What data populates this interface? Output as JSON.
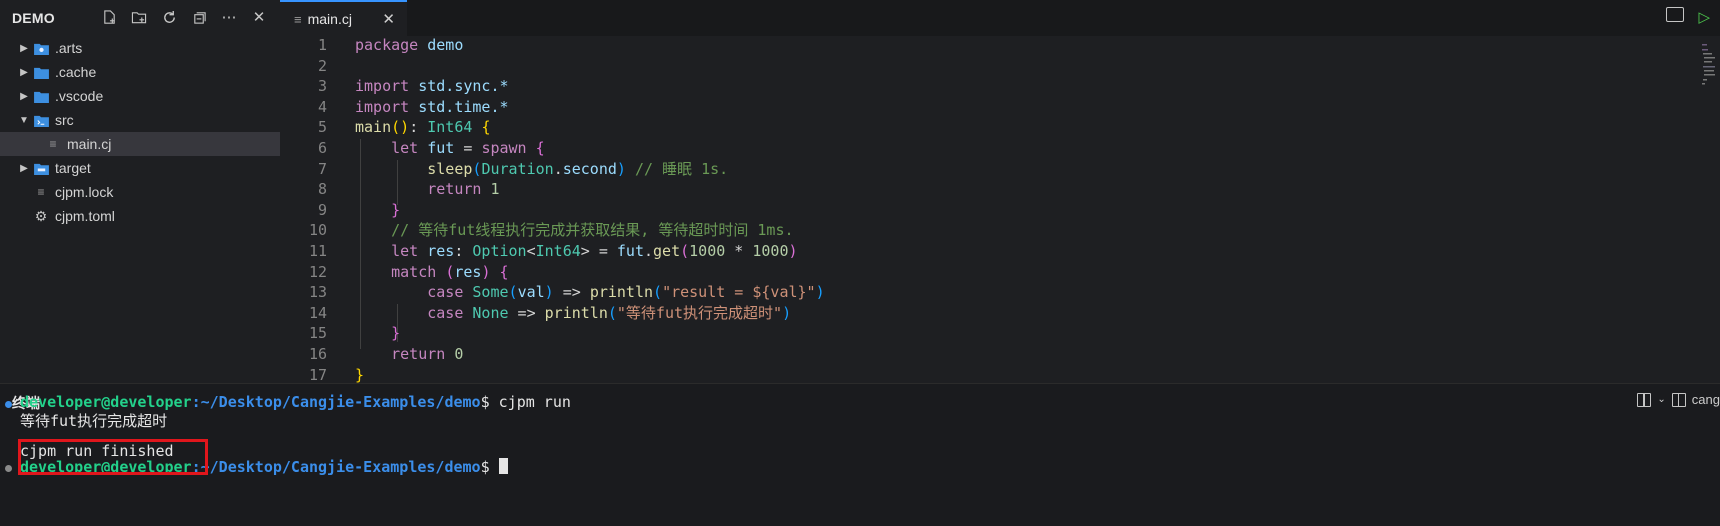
{
  "sidebar": {
    "title": "DEMO",
    "items": [
      {
        "label": ".arts",
        "kind": "folder-collapsed"
      },
      {
        "label": ".cache",
        "kind": "folder-collapsed"
      },
      {
        "label": ".vscode",
        "kind": "folder-collapsed"
      },
      {
        "label": "src",
        "kind": "folder-expanded"
      },
      {
        "label": "main.cj",
        "kind": "file-selected"
      },
      {
        "label": "target",
        "kind": "folder-collapsed"
      },
      {
        "label": "cjpm.lock",
        "kind": "file"
      },
      {
        "label": "cjpm.toml",
        "kind": "settings-file"
      }
    ],
    "actions": [
      "new-file-icon",
      "new-folder-icon",
      "refresh-icon",
      "collapse-all-icon",
      "more-icon",
      "close-icon"
    ]
  },
  "tab": {
    "label": "main.cj"
  },
  "editor": {
    "line_numbers": [
      "1",
      "2",
      "3",
      "4",
      "5",
      "6",
      "7",
      "8",
      "9",
      "10",
      "11",
      "12",
      "13",
      "14",
      "15",
      "16",
      "17"
    ],
    "code": {
      "l1_kw": "package",
      "l1_id": "demo",
      "l3_kw": "import",
      "l3_id": "std.sync.*",
      "l4_kw": "import",
      "l4_id": "std.time.*",
      "l5_fn": "main",
      "l5_p": "()",
      "l5_colon": ": ",
      "l5_ty": "Int64",
      "l5_br": "{",
      "l6_kw": "let",
      "l6_id": "fut",
      "l6_eq": " = ",
      "l6_fn": "spawn",
      "l6_br": "{",
      "l7_fn": "sleep",
      "l7_p1": "(",
      "l7_ty": "Duration",
      "l7_dot": ".",
      "l7_id": "second",
      "l7_p2": ")",
      "l7_cm": "// 睡眠 1s.",
      "l8_kw": "return",
      "l8_nu": "1",
      "l9_br": "}",
      "l10_cm": "// 等待fut线程执行完成并获取结果, 等待超时时间 1ms.",
      "l11_kw": "let",
      "l11_id": "res",
      "l11_colon": ": ",
      "l11_ty1": "Option",
      "l11_lt": "<",
      "l11_ty2": "Int64",
      "l11_gt": ">",
      "l11_eq": " = ",
      "l11_id2": "fut",
      "l11_dot": ".",
      "l11_fn": "get",
      "l11_p1": "(",
      "l11_nu1": "1000",
      "l11_op": " * ",
      "l11_nu2": "1000",
      "l11_p2": ")",
      "l12_kw": "match",
      "l12_p1": "(",
      "l12_id": "res",
      "l12_p2": ")",
      "l12_br": "{",
      "l13_kw": "case",
      "l13_ty": "Some",
      "l13_p1": "(",
      "l13_id": "val",
      "l13_p2": ")",
      "l13_arrow": " => ",
      "l13_fn": "println",
      "l13_p3": "(",
      "l13_st": "\"result = ${val}\"",
      "l13_p4": ")",
      "l14_kw": "case",
      "l14_ty": "None",
      "l14_arrow": " => ",
      "l14_fn": "println",
      "l14_p1": "(",
      "l14_st": "\"等待fut执行完成超时\"",
      "l14_p2": ")",
      "l15_br": "}",
      "l16_kw": "return",
      "l16_nu": "0",
      "l17_br": "}"
    }
  },
  "terminal": {
    "title": "终端",
    "right_label": "cang",
    "prompt_user": "developer@developer",
    "prompt_path": ":~/Desktop/Cangjie-Examples/demo",
    "prompt_symbol": "$",
    "command": " cjpm run",
    "output_line": "等待fut执行完成超时",
    "finished_line": "cjpm run finished"
  },
  "colors": {
    "accent": "#3794ff",
    "run_green": "#4ec94e",
    "prompt_green": "#23d18b",
    "path_blue": "#3b8eea",
    "highlight_red": "#e0161c"
  }
}
